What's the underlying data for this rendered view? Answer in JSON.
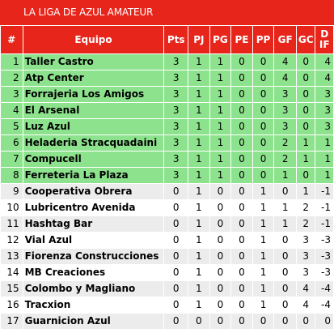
{
  "title": "LA LIGA DE AZUL AMATEUR",
  "colors": {
    "header": "#e8251b",
    "highlight": "#8de38d",
    "row_alt": "#ececec",
    "row": "#ffffff"
  },
  "headers": {
    "pos": "#",
    "team": "Equipo",
    "pts": "Pts",
    "pj": "PJ",
    "pg": "PG",
    "pe": "PE",
    "pp": "PP",
    "gf": "GF",
    "gc": "GC",
    "dif_line1": "D",
    "dif_line2": "IF"
  },
  "rows": [
    {
      "pos": "1",
      "team": "Taller Castro",
      "pts": "3",
      "pj": "1",
      "pg": "1",
      "pe": "0",
      "pp": "0",
      "gf": "4",
      "gc": "0",
      "dif": "4",
      "highlight": true
    },
    {
      "pos": "2",
      "team": "Atp Center",
      "pts": "3",
      "pj": "1",
      "pg": "1",
      "pe": "0",
      "pp": "0",
      "gf": "4",
      "gc": "0",
      "dif": "4",
      "highlight": true
    },
    {
      "pos": "3",
      "team": "Forrajeria Los Amigos",
      "pts": "3",
      "pj": "1",
      "pg": "1",
      "pe": "0",
      "pp": "0",
      "gf": "3",
      "gc": "0",
      "dif": "3",
      "highlight": true
    },
    {
      "pos": "4",
      "team": "El Arsenal",
      "pts": "3",
      "pj": "1",
      "pg": "1",
      "pe": "0",
      "pp": "0",
      "gf": "3",
      "gc": "0",
      "dif": "3",
      "highlight": true
    },
    {
      "pos": "5",
      "team": "Luz Azul",
      "pts": "3",
      "pj": "1",
      "pg": "1",
      "pe": "0",
      "pp": "0",
      "gf": "3",
      "gc": "0",
      "dif": "3",
      "highlight": true
    },
    {
      "pos": "6",
      "team": "Heladeria Stracquadaini",
      "pts": "3",
      "pj": "1",
      "pg": "1",
      "pe": "0",
      "pp": "0",
      "gf": "2",
      "gc": "1",
      "dif": "1",
      "highlight": true
    },
    {
      "pos": "7",
      "team": "Compucell",
      "pts": "3",
      "pj": "1",
      "pg": "1",
      "pe": "0",
      "pp": "0",
      "gf": "2",
      "gc": "1",
      "dif": "1",
      "highlight": true
    },
    {
      "pos": "8",
      "team": "Ferreteria La Plaza",
      "pts": "3",
      "pj": "1",
      "pg": "1",
      "pe": "0",
      "pp": "0",
      "gf": "1",
      "gc": "0",
      "dif": "1",
      "highlight": true
    },
    {
      "pos": "9",
      "team": "Cooperativa Obrera",
      "pts": "0",
      "pj": "1",
      "pg": "0",
      "pe": "0",
      "pp": "1",
      "gf": "0",
      "gc": "1",
      "dif": "-1",
      "highlight": false
    },
    {
      "pos": "10",
      "team": "Lubricentro Avenida",
      "pts": "0",
      "pj": "1",
      "pg": "0",
      "pe": "0",
      "pp": "1",
      "gf": "1",
      "gc": "2",
      "dif": "-1",
      "highlight": false
    },
    {
      "pos": "11",
      "team": "Hashtag Bar",
      "pts": "0",
      "pj": "1",
      "pg": "0",
      "pe": "0",
      "pp": "1",
      "gf": "1",
      "gc": "2",
      "dif": "-1",
      "highlight": false
    },
    {
      "pos": "12",
      "team": "Vial Azul",
      "pts": "0",
      "pj": "1",
      "pg": "0",
      "pe": "0",
      "pp": "1",
      "gf": "0",
      "gc": "3",
      "dif": "-3",
      "highlight": false
    },
    {
      "pos": "13",
      "team": "Fiorenza Construcciones",
      "pts": "0",
      "pj": "1",
      "pg": "0",
      "pe": "0",
      "pp": "1",
      "gf": "0",
      "gc": "3",
      "dif": "-3",
      "highlight": false
    },
    {
      "pos": "14",
      "team": "MB Creaciones",
      "pts": "0",
      "pj": "1",
      "pg": "0",
      "pe": "0",
      "pp": "1",
      "gf": "0",
      "gc": "3",
      "dif": "-3",
      "highlight": false
    },
    {
      "pos": "15",
      "team": "Colombo y Magliano",
      "pts": "0",
      "pj": "1",
      "pg": "0",
      "pe": "0",
      "pp": "1",
      "gf": "0",
      "gc": "4",
      "dif": "-4",
      "highlight": false
    },
    {
      "pos": "16",
      "team": "Tracxion",
      "pts": "0",
      "pj": "1",
      "pg": "0",
      "pe": "0",
      "pp": "1",
      "gf": "0",
      "gc": "4",
      "dif": "-4",
      "highlight": false
    },
    {
      "pos": "17",
      "team": "Guarnicion Azul",
      "pts": "0",
      "pj": "0",
      "pg": "0",
      "pe": "0",
      "pp": "0",
      "gf": "0",
      "gc": "0",
      "dif": "0",
      "highlight": false
    }
  ]
}
